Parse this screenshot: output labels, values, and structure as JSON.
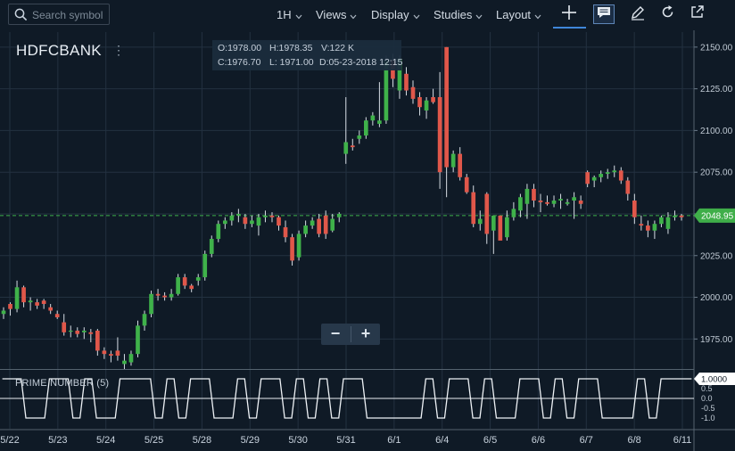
{
  "toolbar": {
    "search_placeholder": "Search symbol",
    "interval": "1H",
    "views": "Views",
    "display": "Display",
    "studies": "Studies",
    "layout": "Layout"
  },
  "symbol": "HDFCBANK",
  "ohlc": {
    "open": "O:1978.00",
    "high": "H:1978.35",
    "volume": "V:122 K",
    "close": "C:1976.70",
    "low": "L: 1971.00",
    "date": "D:05-23-2018 12:15"
  },
  "last_price": "2048.95",
  "indicator": {
    "name": "PRIME NUMBER (5)",
    "value_label": "1.0000",
    "ticks": [
      "1.0",
      "0.5",
      "0.0",
      "-0.5",
      "-1.0"
    ]
  },
  "colors": {
    "background": "#0f1a26",
    "up": "#3fb24a",
    "down": "#e0574a",
    "price_line": "#3fae49",
    "grid": "#233140"
  },
  "chart_data": {
    "type": "candlestick",
    "x_labels": [
      "5/22",
      "5/23",
      "5/24",
      "5/25",
      "5/28",
      "5/29",
      "5/30",
      "5/31",
      "6/1",
      "6/4",
      "6/5",
      "6/6",
      "6/7",
      "6/8",
      "6/11"
    ],
    "y_ticks": [
      1975,
      2000,
      2025,
      2050,
      2075,
      2100,
      2125,
      2150
    ],
    "y_tick_labels": [
      "1975.00",
      "2000.00",
      "2025.00",
      "2050.00",
      "2075.00",
      "2100.00",
      "2125.00",
      "2150.00"
    ],
    "ylim": [
      1957,
      2159
    ],
    "last_price": 2048.95,
    "candles": [
      [
        1990,
        1994,
        1987,
        1992
      ],
      [
        1996,
        1997,
        1989,
        1993
      ],
      [
        1993,
        2010,
        1991,
        2006
      ],
      [
        2006,
        2007,
        1994,
        1997
      ],
      [
        1997,
        2000,
        1992,
        1998
      ],
      [
        1997,
        1999,
        1993,
        1995
      ],
      [
        1998,
        1999,
        1993,
        1996
      ],
      [
        1994,
        1996,
        1990,
        1992
      ],
      [
        1990,
        1992,
        1987,
        1988
      ],
      [
        1985,
        1990,
        1977,
        1979
      ],
      [
        1980,
        1983,
        1976,
        1980
      ],
      [
        1980,
        1982,
        1976,
        1978
      ],
      [
        1979,
        1982,
        1975,
        1980
      ],
      [
        1979,
        1981,
        1973,
        1978
      ],
      [
        1980,
        1981,
        1965,
        1968
      ],
      [
        1968,
        1970,
        1963,
        1966
      ],
      [
        1966,
        1968,
        1961,
        1965
      ],
      [
        1968,
        1976,
        1962,
        1965
      ],
      [
        1960,
        1966,
        1957,
        1962
      ],
      [
        1961,
        1968,
        1959,
        1966
      ],
      [
        1966,
        1986,
        1964,
        1983
      ],
      [
        1983,
        1992,
        1980,
        1990
      ],
      [
        1990,
        2004,
        1988,
        2002
      ],
      [
        2002,
        2005,
        1998,
        2001
      ],
      [
        2001,
        2003,
        1998,
        2000
      ],
      [
        2000,
        2005,
        1998,
        2002
      ],
      [
        2002,
        2014,
        2001,
        2012
      ],
      [
        2012,
        2014,
        2005,
        2007
      ],
      [
        2007,
        2008,
        2003,
        2005
      ],
      [
        2010,
        2014,
        2007,
        2012
      ],
      [
        2012,
        2028,
        2010,
        2026
      ],
      [
        2026,
        2037,
        2024,
        2035
      ],
      [
        2035,
        2046,
        2033,
        2044
      ],
      [
        2044,
        2048,
        2041,
        2046
      ],
      [
        2046,
        2051,
        2043,
        2049
      ],
      [
        2049,
        2053,
        2045,
        2050
      ],
      [
        2048,
        2050,
        2041,
        2044
      ],
      [
        2044,
        2049,
        2042,
        2046
      ],
      [
        2043,
        2050,
        2037,
        2048
      ],
      [
        2048,
        2052,
        2045,
        2049
      ],
      [
        2049,
        2051,
        2045,
        2048
      ],
      [
        2048,
        2049,
        2040,
        2043
      ],
      [
        2042,
        2046,
        2033,
        2036
      ],
      [
        2036,
        2038,
        2019,
        2022
      ],
      [
        2024,
        2040,
        2022,
        2038
      ],
      [
        2038,
        2046,
        2036,
        2043
      ],
      [
        2043,
        2048,
        2041,
        2046
      ],
      [
        2047,
        2050,
        2036,
        2038
      ],
      [
        2049,
        2052,
        2035,
        2038
      ],
      [
        2040,
        2050,
        2039,
        2047
      ],
      [
        2048,
        2051,
        2045,
        2050
      ],
      [
        2086,
        2120,
        2080,
        2093
      ],
      [
        2091,
        2095,
        2088,
        2090
      ],
      [
        2095,
        2100,
        2092,
        2097
      ],
      [
        2097,
        2108,
        2095,
        2106
      ],
      [
        2106,
        2111,
        2103,
        2109
      ],
      [
        2104,
        2129,
        2102,
        2106
      ],
      [
        2106,
        2145,
        2104,
        2142
      ],
      [
        2142,
        2146,
        2126,
        2131
      ],
      [
        2124,
        2145,
        2119,
        2143
      ],
      [
        2134,
        2138,
        2121,
        2124
      ],
      [
        2126,
        2130,
        2116,
        2119
      ],
      [
        2120,
        2123,
        2109,
        2114
      ],
      [
        2112,
        2120,
        2107,
        2118
      ],
      [
        2120,
        2125,
        2116,
        2117
      ],
      [
        2120,
        2135,
        2065,
        2075
      ],
      [
        2150,
        2150,
        2060,
        2078
      ],
      [
        2078,
        2088,
        2075,
        2086
      ],
      [
        2086,
        2090,
        2070,
        2072
      ],
      [
        2072,
        2074,
        2062,
        2063
      ],
      [
        2063,
        2067,
        2042,
        2044
      ],
      [
        2044,
        2052,
        2040,
        2047
      ],
      [
        2062,
        2063,
        2032,
        2038
      ],
      [
        2040,
        2049,
        2026,
        2049
      ],
      [
        2049,
        2049,
        2035,
        2034
      ],
      [
        2036,
        2052,
        2034,
        2048
      ],
      [
        2048,
        2057,
        2046,
        2053
      ],
      [
        2052,
        2062,
        2048,
        2060
      ],
      [
        2056,
        2068,
        2047,
        2065
      ],
      [
        2065,
        2068,
        2054,
        2058
      ],
      [
        2058,
        2062,
        2051,
        2057
      ],
      [
        2057,
        2061,
        2055,
        2056
      ],
      [
        2056,
        2061,
        2054,
        2058
      ],
      [
        2058,
        2062,
        2053,
        2059
      ],
      [
        2056,
        2059,
        2055,
        2057
      ],
      [
        2058,
        2063,
        2047,
        2060
      ],
      [
        2058,
        2061,
        2053,
        2056
      ],
      [
        2075,
        2076,
        2066,
        2068
      ],
      [
        2070,
        2073,
        2066,
        2072
      ],
      [
        2072,
        2076,
        2069,
        2074
      ],
      [
        2074,
        2077,
        2071,
        2075
      ],
      [
        2075,
        2079,
        2072,
        2076
      ],
      [
        2076,
        2078,
        2068,
        2070
      ],
      [
        2070,
        2072,
        2058,
        2062
      ],
      [
        2058,
        2062,
        2044,
        2048
      ],
      [
        2044,
        2049,
        2040,
        2043
      ],
      [
        2043,
        2046,
        2036,
        2040
      ],
      [
        2040,
        2046,
        2035,
        2044
      ],
      [
        2044,
        2049,
        2042,
        2048
      ],
      [
        2041,
        2051,
        2038,
        2048
      ],
      [
        2048,
        2052,
        2046,
        2049
      ],
      [
        2049,
        2050,
        2046,
        2048
      ]
    ]
  }
}
